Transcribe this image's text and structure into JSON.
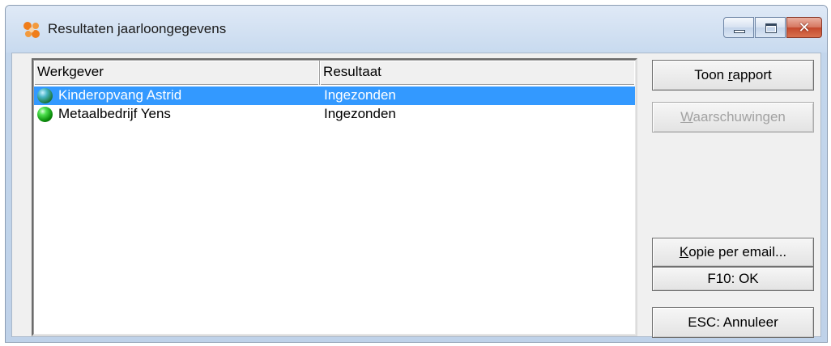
{
  "window": {
    "title": "Resultaten jaarloongegevens",
    "icon": "orange-app-icon"
  },
  "caption_buttons": {
    "minimize_icon": "minimize-icon",
    "maximize_icon": "maximize-icon",
    "close_icon": "close-icon",
    "close_glyph": "✕"
  },
  "list": {
    "columns": [
      "Werkgever",
      "Resultaat"
    ],
    "rows": [
      {
        "werkgever": "Kinderopvang Astrid",
        "resultaat": "Ingezonden",
        "selected": true,
        "status_icon": "green-ball-icon"
      },
      {
        "werkgever": "Metaalbedrijf Yens",
        "resultaat": "Ingezonden",
        "selected": false,
        "status_icon": "green-ball-icon"
      }
    ]
  },
  "buttons": {
    "toon_rapport": {
      "pre": "Toon ",
      "accel": "r",
      "post": "apport",
      "enabled": true
    },
    "waarschuwingen": {
      "pre": "",
      "accel": "W",
      "post": "aarschuwingen",
      "enabled": false
    },
    "kopie_email": {
      "pre": "",
      "accel": "K",
      "post": "opie per email...",
      "enabled": true
    },
    "f10_ok": {
      "label": "F10: OK",
      "enabled": true
    },
    "esc_annuleer": {
      "label": "ESC: Annuleer",
      "enabled": true
    }
  },
  "colors": {
    "selection": "#3399ff",
    "accent_orange": "#f07d1a",
    "close_red": "#c4492d"
  }
}
